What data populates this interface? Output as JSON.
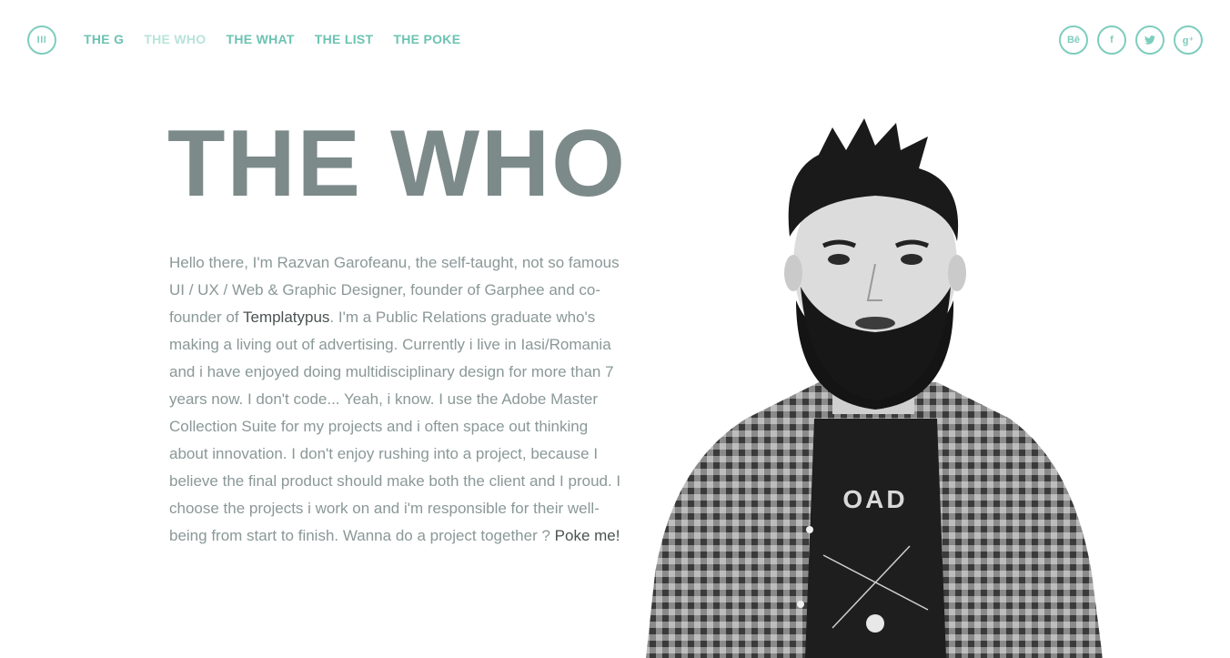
{
  "header": {
    "menu_icon_label": "III",
    "nav": [
      {
        "label": "THE G",
        "active": false
      },
      {
        "label": "THE WHO",
        "active": true
      },
      {
        "label": "THE WHAT",
        "active": false
      },
      {
        "label": "THE LIST",
        "active": false
      },
      {
        "label": "THE POKE",
        "active": false
      }
    ],
    "social": [
      {
        "icon": "behance-icon",
        "glyph": "Bē"
      },
      {
        "icon": "facebook-icon",
        "glyph": "f"
      },
      {
        "icon": "twitter-icon",
        "glyph": "t"
      },
      {
        "icon": "google-plus-icon",
        "glyph": "g⁺"
      }
    ]
  },
  "main": {
    "title": "THE WHO",
    "bio_part1": "Hello there, I'm Razvan Garofeanu, the self-taught, not so famous UI / UX / Web & Graphic Designer, founder of Garphee and co-founder of ",
    "bio_link1": "Templatypus",
    "bio_part2": ". I'm a Public Relations graduate who's making a living out of advertising. Currently i live in Iasi/Romania and i have enjoyed doing multidisciplinary design for more than 7 years now. I don't code... Yeah, i know. I use the Adobe Master Collection Suite for my projects and i often space out thinking about innovation. I don't enjoy rushing into a project, because I believe the final product should make both the client and I proud. I choose the projects i work on and i'm responsible for their well-being from start to finish. Wanna do a project together ? ",
    "bio_link2": "Poke me!",
    "portrait_shirt_text": "OAD"
  },
  "colors": {
    "accent": "#7ecdbd",
    "nav_active": "#b8e3d9",
    "title": "#7c8a89",
    "body_text": "#8a9897",
    "link_text": "#4a5252"
  }
}
